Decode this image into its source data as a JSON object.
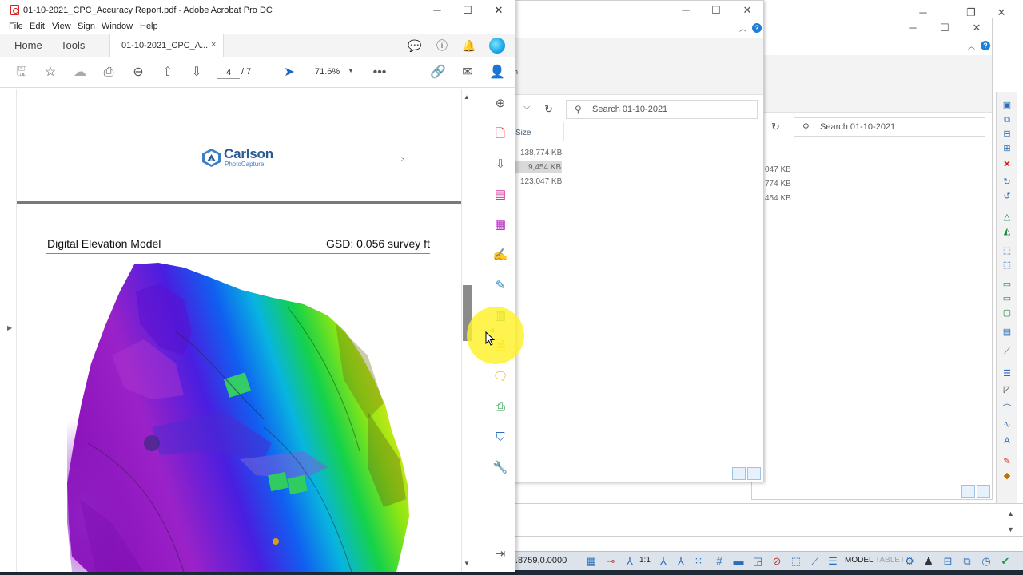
{
  "acrobat": {
    "window_title": "01-10-2021_CPC_Accuracy Report.pdf - Adobe Acrobat Pro DC",
    "menu": [
      "File",
      "Edit",
      "View",
      "Sign",
      "Window",
      "Help"
    ],
    "tabs": {
      "home": "Home",
      "tools": "Tools",
      "doc": "01-10-2021_CPC_A...",
      "close": "×"
    },
    "toolbar": {
      "current_page": "4",
      "total_pages": "/ 7",
      "zoom": "71.6%"
    },
    "window_controls": {
      "minimize": "─",
      "maximize": "☐",
      "close": "✕"
    }
  },
  "document": {
    "logo_name": "Carlson",
    "logo_sub": "PhotoCapture",
    "page3_number": "3",
    "section_title": "Digital Elevation Model",
    "gsd": "GSD: 0.056 survey ft"
  },
  "explorer1": {
    "search_placeholder": "Search 01-10-2021",
    "size_header": "Size",
    "sizes": [
      "138,774 KB",
      "9,454 KB",
      "123,047 KB"
    ],
    "ribbon_fragment": "n"
  },
  "explorer2": {
    "search_placeholder": "Search 01-10-2021",
    "sizes": [
      "047 KB",
      "774 KB",
      "454 KB"
    ]
  },
  "cad": {
    "coords": ".8759,0.0000",
    "model_label": "MODEL",
    "tablet_label": "TABLET",
    "scale_label": "1:1"
  },
  "colors": {
    "acrobat_red": "#d22222",
    "accent_blue": "#1e7fd6",
    "cursor_highlight": "#fff028"
  },
  "icons": {
    "tools_pane": [
      "zoom-in-icon",
      "create-pdf-icon",
      "export-pdf-icon",
      "organize-pages-icon",
      "edit-pdf-icon",
      "fill-sign-icon",
      "send-for-signature-icon",
      "scan-ocr-icon",
      "send-for-comment-icon",
      "comment-icon",
      "print-production-icon",
      "protect-icon",
      "more-tools-icon",
      "expand-panel-icon"
    ]
  }
}
